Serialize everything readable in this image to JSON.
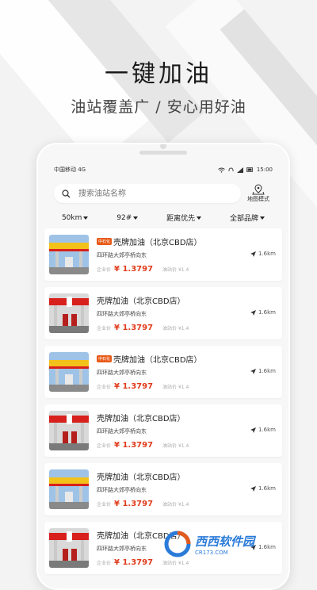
{
  "hero": {
    "title": "一键加油",
    "subtitle": "油站覆盖广 / 安心用好油"
  },
  "status_bar": {
    "carrier": "中国移动 4G",
    "time": "15:00"
  },
  "search": {
    "placeholder": "搜索油站名称",
    "map_mode_label": "地图模式"
  },
  "filters": [
    {
      "label": "50km"
    },
    {
      "label": "92#"
    },
    {
      "label": "距离优先"
    },
    {
      "label": "全部品牌"
    }
  ],
  "stations": [
    {
      "badge": "中石化",
      "name": "壳牌加油（北京CBD店）",
      "address": "四环路大郊亭桥向东",
      "distance": "1.6km",
      "price_label": "企业价",
      "price": "¥ 1.3797",
      "station_price_label": "油站价 ¥1.4",
      "image": "yellow"
    },
    {
      "badge": "",
      "name": "壳牌加油（北京CBD店）",
      "address": "四环路大郊亭桥向东",
      "distance": "1.6km",
      "price_label": "企业价",
      "price": "¥ 1.3797",
      "station_price_label": "油站价 ¥1.4",
      "image": "red"
    },
    {
      "badge": "中石化",
      "name": "壳牌加油（北京CBD店）",
      "address": "四环路大郊亭桥向东",
      "distance": "1.6km",
      "price_label": "企业价",
      "price": "¥ 1.3797",
      "station_price_label": "油站价 ¥1.4",
      "image": "yellow"
    },
    {
      "badge": "",
      "name": "壳牌加油（北京CBD店）",
      "address": "四环路大郊亭桥向东",
      "distance": "1.6km",
      "price_label": "企业价",
      "price": "¥ 1.3797",
      "station_price_label": "油站价 ¥1.4",
      "image": "red"
    },
    {
      "badge": "",
      "name": "壳牌加油（北京CBD店）",
      "address": "四环路大郊亭桥向东",
      "distance": "1.6km",
      "price_label": "企业价",
      "price": "¥ 1.3797",
      "station_price_label": "油站价 ¥1.4",
      "image": "yellow"
    },
    {
      "badge": "",
      "name": "壳牌加油（北京CBD店）",
      "address": "四环路大郊亭桥向东",
      "distance": "1.6km",
      "price_label": "企业价",
      "price": "¥ 1.3797",
      "station_price_label": "油站价 ¥1.4",
      "image": "red"
    }
  ],
  "watermark": {
    "brand": "西西软件园",
    "url": "CR173.COM"
  },
  "colors": {
    "accent_price": "#e03a1a",
    "badge": "#e85a18",
    "watermark_orange": "#e35b1d",
    "watermark_blue": "#2b7bd8"
  }
}
